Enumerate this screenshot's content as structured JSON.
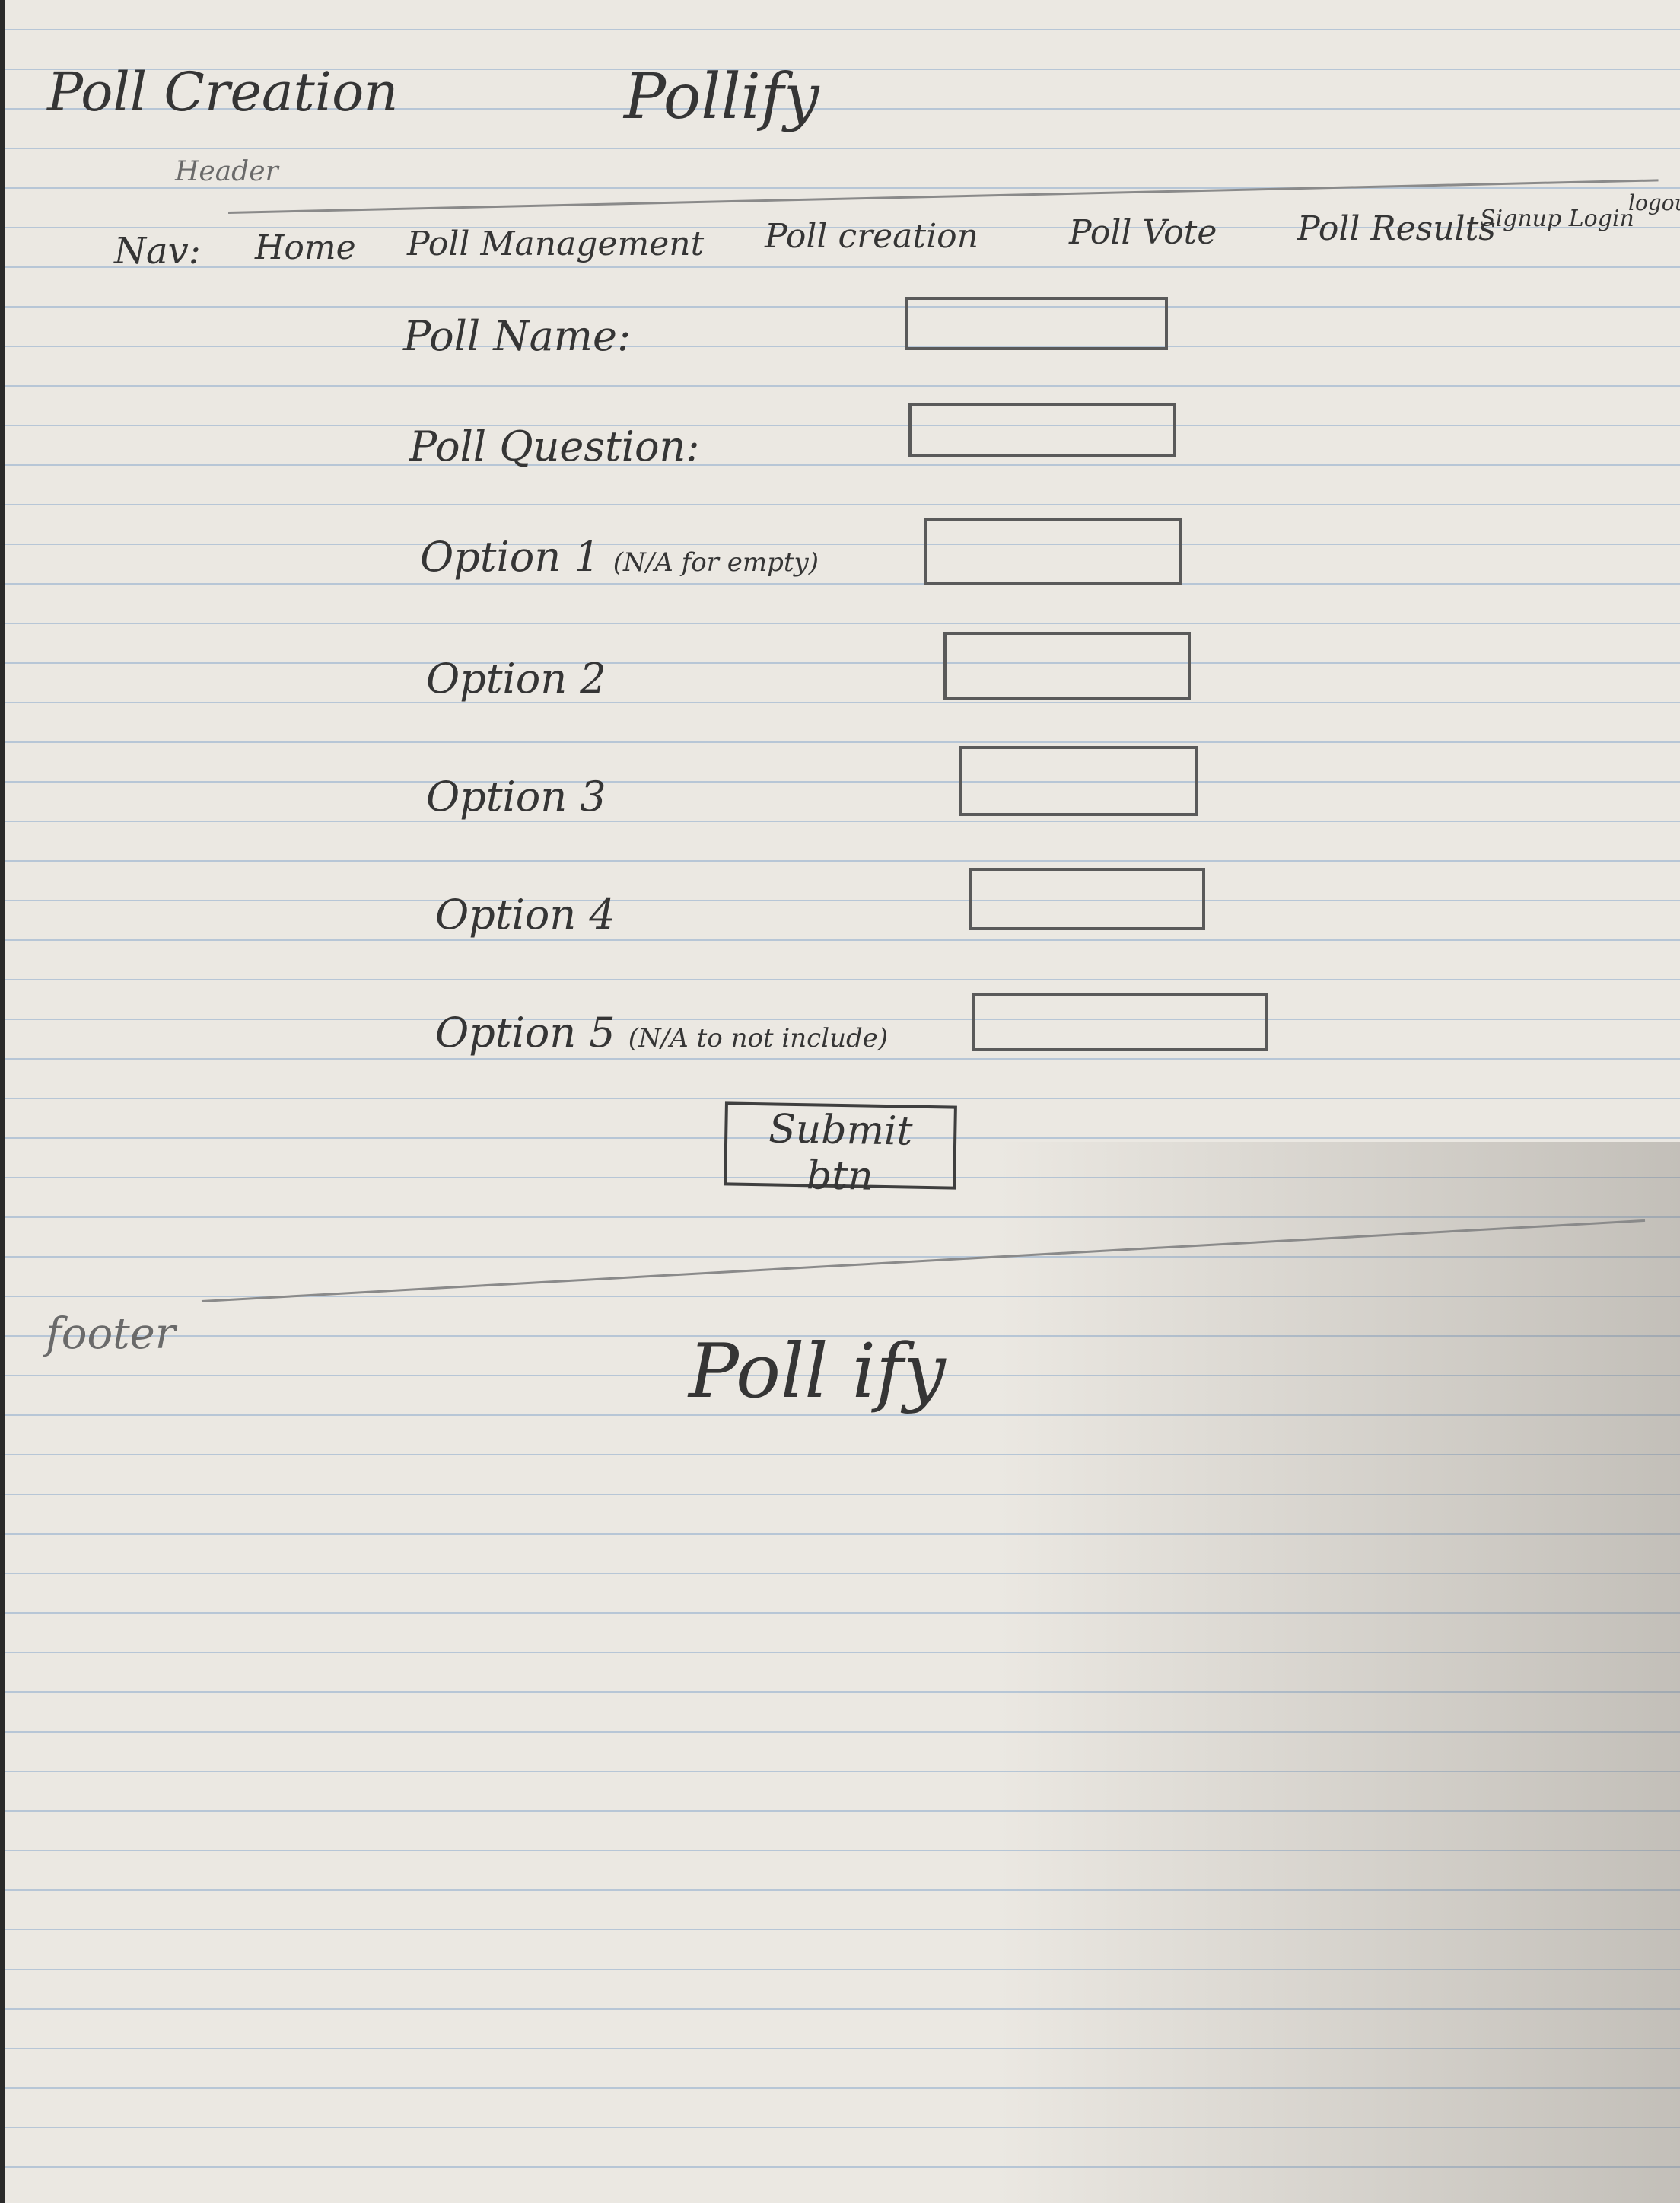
{
  "page_label": "Poll Creation",
  "brand": "Pollify",
  "header_label": "Header",
  "nav": {
    "label": "Nav:",
    "items": [
      {
        "label": "Home"
      },
      {
        "label": "Poll Management"
      },
      {
        "label": "Poll creation"
      },
      {
        "label": "Poll Vote"
      },
      {
        "label": "Poll Results"
      },
      {
        "label": "Signup Login"
      },
      {
        "label": "logout"
      }
    ]
  },
  "form": {
    "fields": [
      {
        "label": "Poll Name:",
        "note": ""
      },
      {
        "label": "Poll Question:",
        "note": ""
      },
      {
        "label": "Option 1",
        "note": "(N/A for empty)"
      },
      {
        "label": "Option 2",
        "note": ""
      },
      {
        "label": "Option 3",
        "note": ""
      },
      {
        "label": "Option 4",
        "note": ""
      },
      {
        "label": "Option 5",
        "note": "(N/A to not include)"
      }
    ],
    "submit_label": "Submit btn"
  },
  "footer": {
    "label": "footer",
    "brand": "Poll ify"
  },
  "colors": {
    "paper": "#ebe8e2",
    "rule_lines": "#8caacd",
    "pencil": "#353535"
  }
}
